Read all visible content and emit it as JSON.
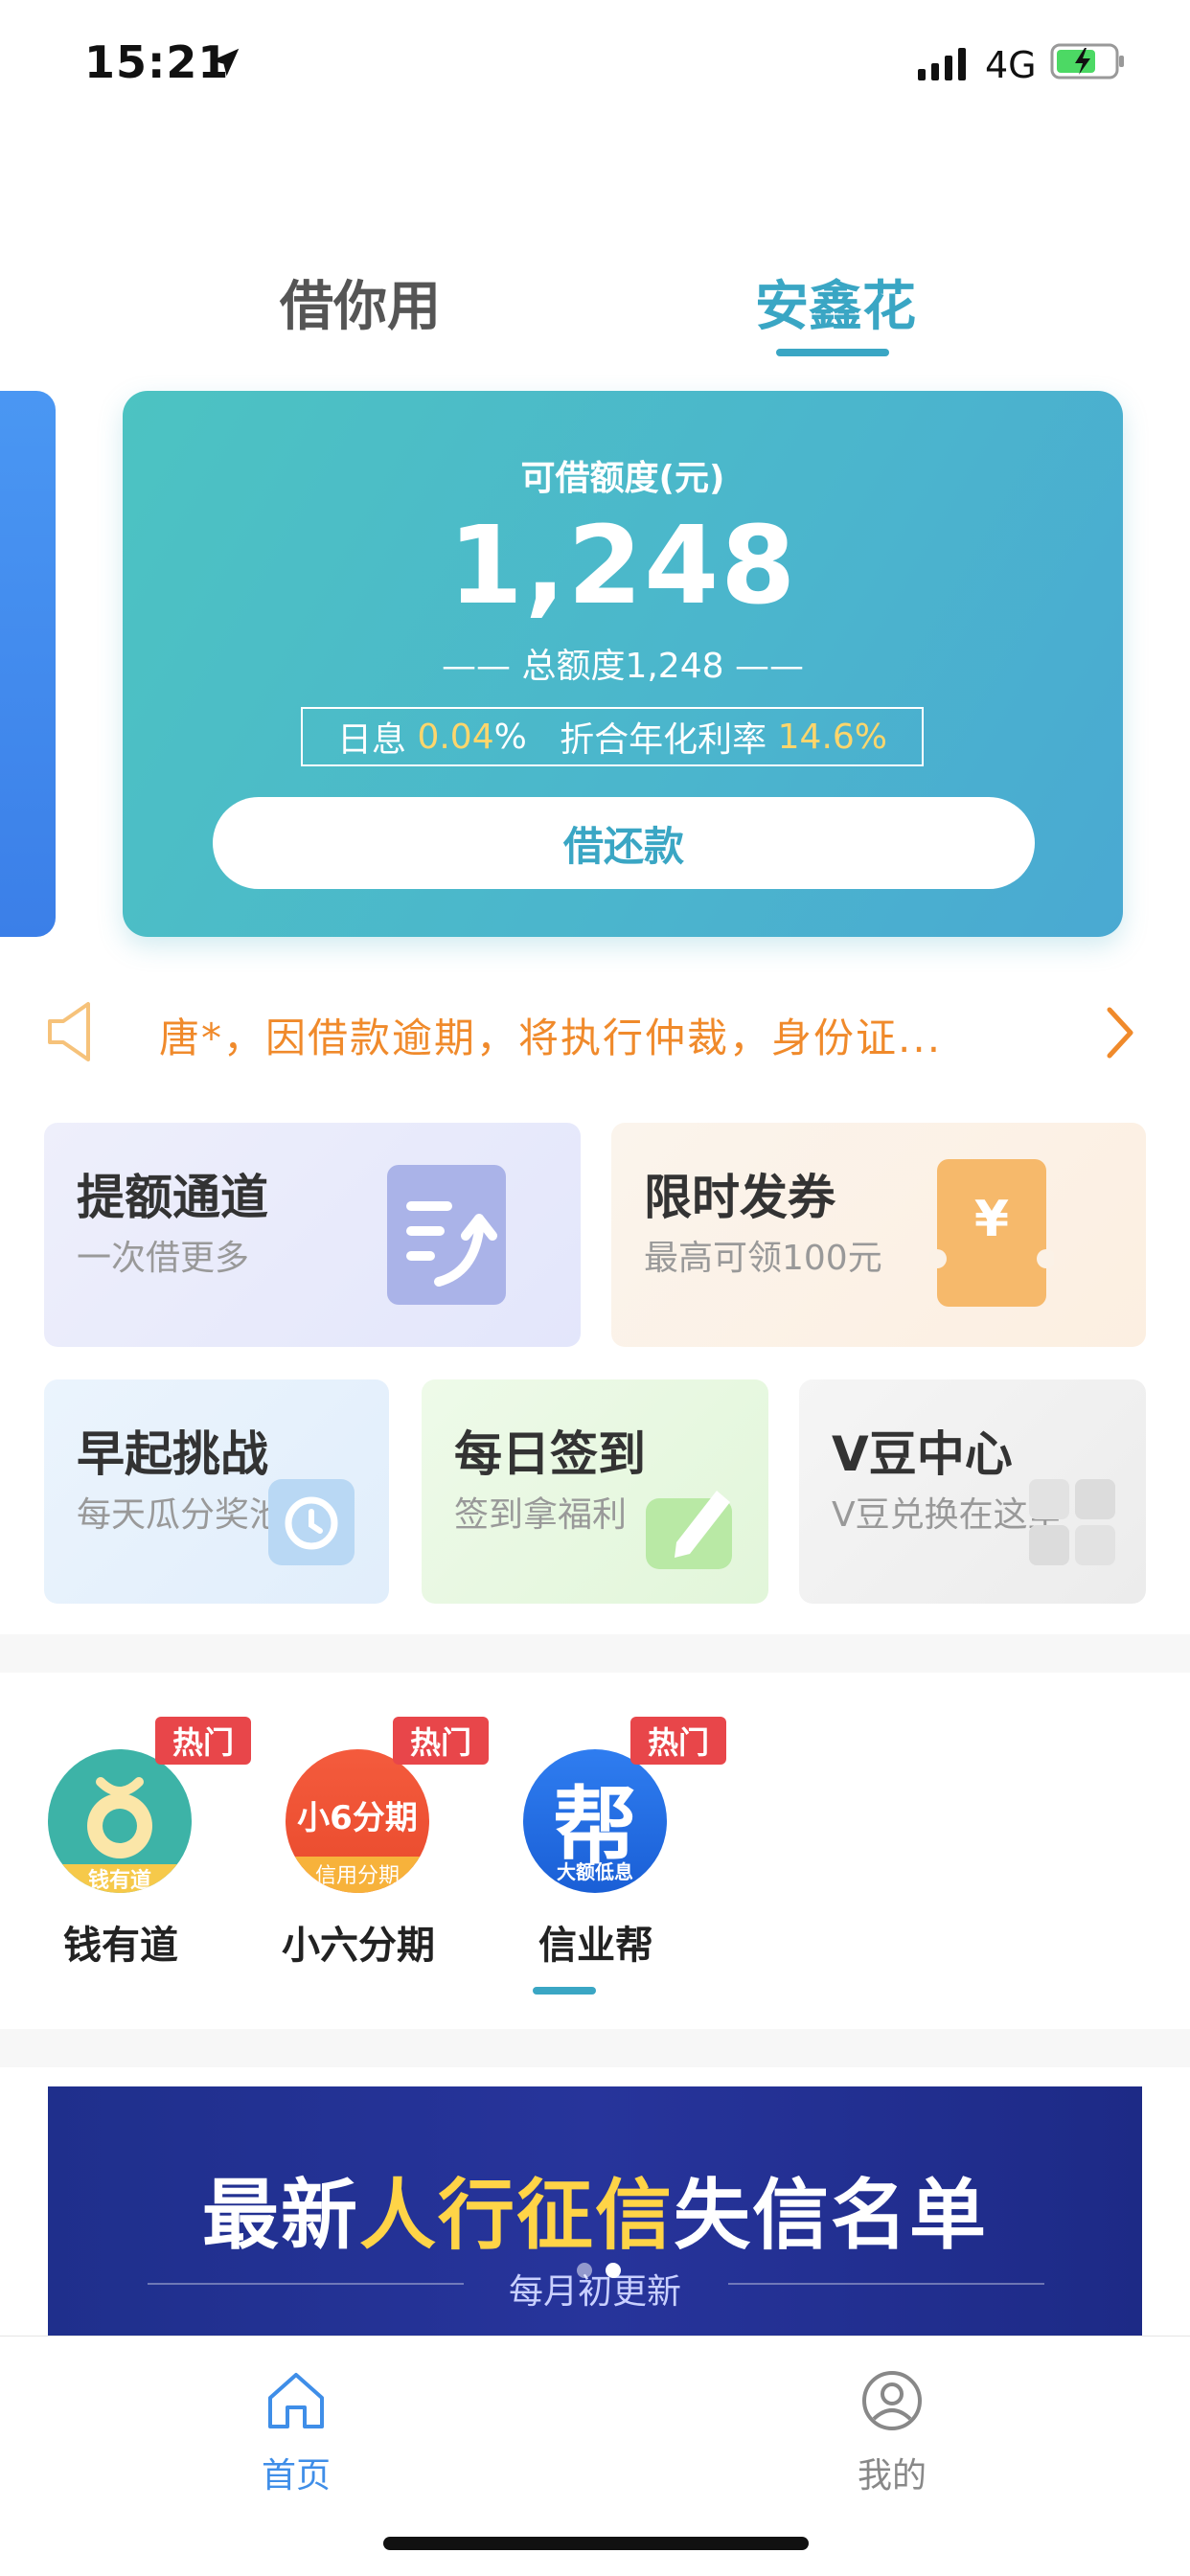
{
  "status_bar": {
    "time": "15:21",
    "network": "4G"
  },
  "tabs": [
    {
      "label": "借你用",
      "active": false
    },
    {
      "label": "安鑫花",
      "active": true
    }
  ],
  "card": {
    "limit_label": "可借额度(元)",
    "limit_value": "1,248",
    "total_text": "—— 总额度1,248 ——",
    "daily_rate_label": "日息",
    "daily_rate_value": "0.04",
    "daily_rate_unit": "%",
    "annual_rate_label": "折合年化利率",
    "annual_rate_value": "14.6%",
    "repay_button": "借还款"
  },
  "notice": {
    "text": "唐*，因借款逾期，将执行仲裁，身份证..."
  },
  "features": {
    "raise": {
      "title": "提额通道",
      "subtitle": "一次借更多"
    },
    "coupon": {
      "title": "限时发券",
      "subtitle": "最高可领100元",
      "icon_glyph": "¥"
    },
    "early": {
      "title": "早起挑战",
      "subtitle": "每天瓜分奖池"
    },
    "sign": {
      "title": "每日签到",
      "subtitle": "签到拿福利"
    },
    "vbean": {
      "title": "V豆中心",
      "subtitle": "V豆兑换在这里"
    }
  },
  "hot_apps": [
    {
      "name": "钱有道",
      "badge": "热门",
      "icon_text": "钱有道"
    },
    {
      "name": "小六分期",
      "badge": "热门",
      "icon_text": "小6分期",
      "icon_subtext": "信用分期"
    },
    {
      "name": "信业帮",
      "badge": "热门",
      "icon_text": "帮",
      "icon_subtext": "大额低息"
    }
  ],
  "banner": {
    "title_prefix": "最新",
    "title_highlight": "人行征信",
    "title_suffix": "失信名单",
    "subtitle": "每月初更新"
  },
  "tab_bar": [
    {
      "label": "首页",
      "active": true,
      "icon": "home-icon"
    },
    {
      "label": "我的",
      "active": false,
      "icon": "profile-icon"
    }
  ],
  "colors": {
    "accent": "#3aa6c4",
    "notice": "#f08a2b",
    "hot_badge": "#e8464a",
    "nav_active": "#3f8ee8"
  }
}
